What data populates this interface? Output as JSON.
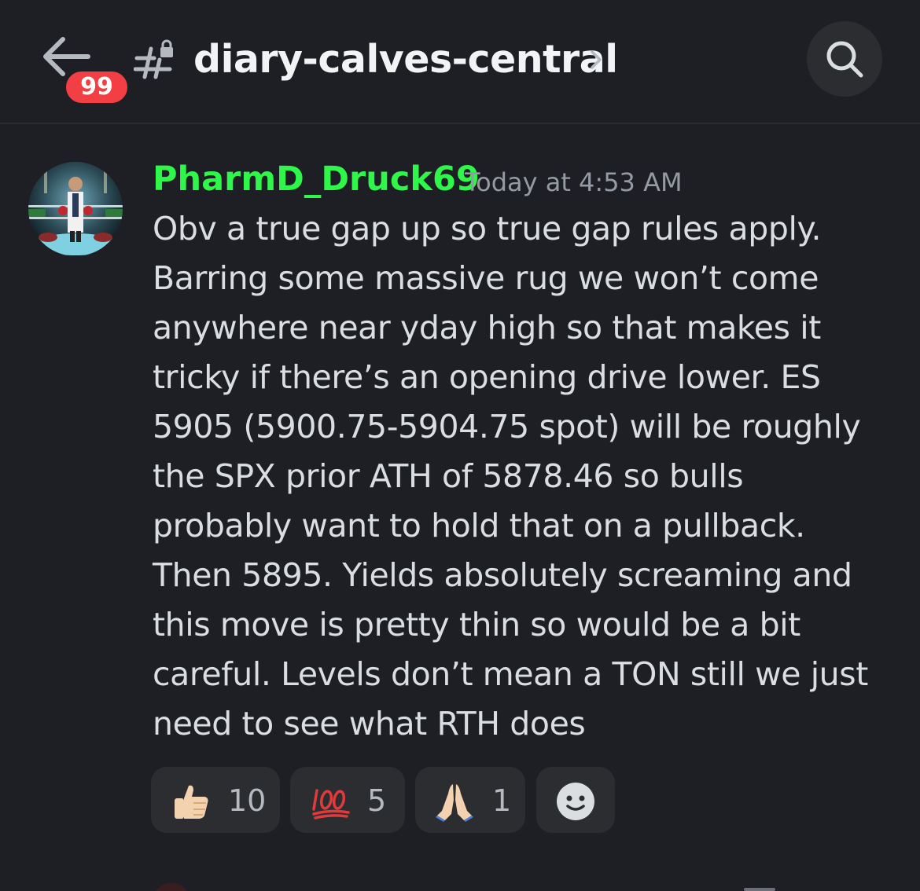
{
  "header": {
    "back_icon": "arrow-left-icon",
    "unread_badge": "99",
    "channel_icon": "hashtag-lock-icon",
    "channel_name": "diary-calves-central",
    "chevron_icon": "chevron-right-icon",
    "search_icon": "search-icon"
  },
  "message": {
    "author": "PharmD_Druck69",
    "author_color": "#2ff74a",
    "timestamp": "Today at 4:53 AM",
    "lines": [
      "Obv a true gap up so true gap rules apply.",
      "Barring some massive rug we won’t come",
      "anywhere near yday high so that makes it",
      "tricky if there’s an opening drive lower. ES",
      "5905 (5900.75-5904.75 spot) will be roughly",
      "the SPX prior ATH of 5878.46 so bulls",
      "probably want to hold that on a pullback.",
      "Then 5895. Yields absolutely screaming and",
      "this move is pretty thin so would be a bit",
      "careful. Levels don’t mean a TON still we just",
      "need to see what RTH does"
    ]
  },
  "reactions": [
    {
      "emoji": "thumbs-up-icon",
      "count": "10"
    },
    {
      "emoji": "hundred-points-icon",
      "count": "5"
    },
    {
      "emoji": "folded-hands-icon",
      "count": "1"
    },
    {
      "emoji": "add-reaction-smiley-icon",
      "count": ""
    }
  ],
  "colors": {
    "background": "#1e1f24",
    "badge": "#f23f43",
    "reaction_bg": "#2b2d31"
  }
}
